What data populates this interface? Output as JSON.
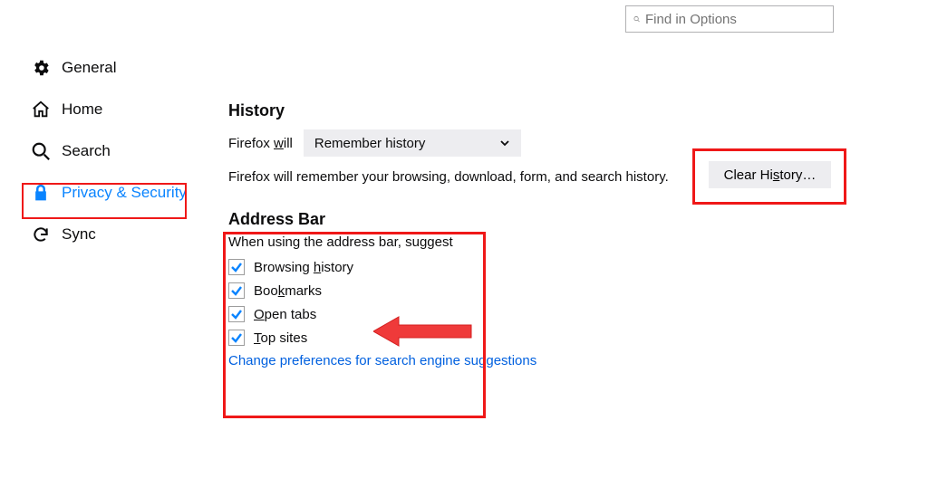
{
  "search": {
    "placeholder": "Find in Options"
  },
  "sidebar": {
    "items": [
      {
        "label": "General"
      },
      {
        "label": "Home"
      },
      {
        "label": "Search"
      },
      {
        "label": "Privacy & Security"
      },
      {
        "label": "Sync"
      }
    ]
  },
  "history": {
    "heading": "History",
    "will_pre": "Firefox ",
    "will_key": "w",
    "will_post": "ill",
    "select_value": "Remember history",
    "desc": "Firefox will remember your browsing, download, form, and search history.",
    "clear_pre": "Clear Hi",
    "clear_key": "s",
    "clear_post": "tory…"
  },
  "addressBar": {
    "heading": "Address Bar",
    "intro": "When using the address bar, suggest",
    "options": [
      {
        "pre": "Browsing ",
        "key": "h",
        "post": "istory",
        "checked": true
      },
      {
        "pre": "Boo",
        "key": "k",
        "post": "marks",
        "checked": true
      },
      {
        "pre": "",
        "key": "O",
        "post": "pen tabs",
        "checked": true
      },
      {
        "pre": "",
        "key": "T",
        "post": "op sites",
        "checked": true
      }
    ],
    "link": "Change preferences for search engine suggestions"
  }
}
